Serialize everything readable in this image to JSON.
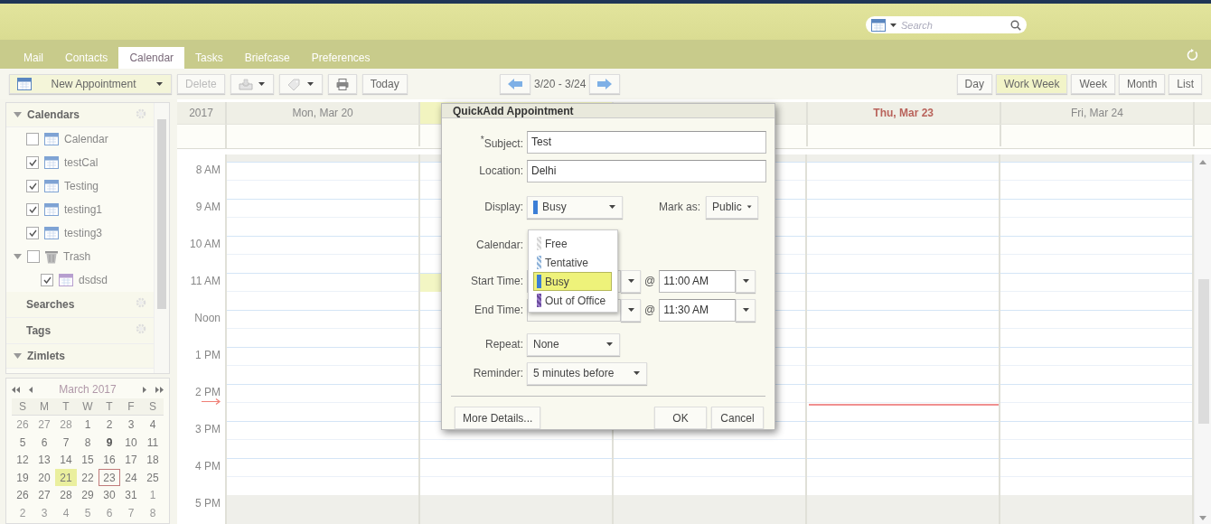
{
  "search": {
    "placeholder": "Search"
  },
  "tabs": [
    {
      "label": "Mail",
      "selected": false
    },
    {
      "label": "Contacts",
      "selected": false
    },
    {
      "label": "Calendar",
      "selected": true
    },
    {
      "label": "Tasks",
      "selected": false
    },
    {
      "label": "Briefcase",
      "selected": false
    },
    {
      "label": "Preferences",
      "selected": false
    }
  ],
  "toolbar": {
    "new_button": "New Appointment",
    "delete_button": "Delete",
    "today_button": "Today",
    "date_range": "3/20 - 3/24",
    "views": [
      {
        "label": "Day",
        "selected": false
      },
      {
        "label": "Work Week",
        "selected": true
      },
      {
        "label": "Week",
        "selected": false
      },
      {
        "label": "Month",
        "selected": false
      },
      {
        "label": "List",
        "selected": false
      }
    ]
  },
  "sidebar": {
    "sections": [
      {
        "title": "Calendars",
        "expanded": true,
        "items": [
          {
            "name": "Calendar",
            "kind": "calendar",
            "checked": false
          },
          {
            "name": "testCal",
            "kind": "calendar",
            "checked": true
          },
          {
            "name": "Testing",
            "kind": "calendar",
            "checked": true
          },
          {
            "name": "testing1",
            "kind": "calendar",
            "checked": true
          },
          {
            "name": "testing3",
            "kind": "calendar",
            "checked": true
          },
          {
            "name": "Trash",
            "kind": "trash",
            "checked": false,
            "children": [
              {
                "name": "dsdsd",
                "kind": "calendar",
                "checked": true
              }
            ]
          }
        ]
      },
      {
        "title": "Searches",
        "expanded": false
      },
      {
        "title": "Tags",
        "expanded": false
      },
      {
        "title": "Zimlets",
        "expanded": true
      }
    ]
  },
  "mini_calendar": {
    "title": "March 2017",
    "weekdays": [
      "S",
      "M",
      "T",
      "W",
      "T",
      "F",
      "S"
    ],
    "weeks": [
      [
        {
          "day": "26",
          "kind": "outside",
          "selected": false,
          "today": false
        },
        {
          "day": "27",
          "kind": "outside",
          "selected": false,
          "today": false
        },
        {
          "day": "28",
          "kind": "outside",
          "selected": false,
          "today": false
        },
        {
          "day": "1",
          "kind": "inside",
          "selected": false,
          "today": false
        },
        {
          "day": "2",
          "kind": "inside",
          "selected": false,
          "today": false
        },
        {
          "day": "3",
          "kind": "inside",
          "selected": false,
          "today": false
        },
        {
          "day": "4",
          "kind": "inside",
          "selected": false,
          "today": false
        }
      ],
      [
        {
          "day": "5",
          "kind": "inside",
          "selected": false,
          "today": false
        },
        {
          "day": "6",
          "kind": "inside",
          "selected": false,
          "today": false
        },
        {
          "day": "7",
          "kind": "inside",
          "selected": false,
          "today": false
        },
        {
          "day": "8",
          "kind": "inside",
          "selected": false,
          "today": false
        },
        {
          "day": "9",
          "kind": "busy",
          "selected": false,
          "today": false
        },
        {
          "day": "10",
          "kind": "inside",
          "selected": false,
          "today": false
        },
        {
          "day": "11",
          "kind": "inside",
          "selected": false,
          "today": false
        }
      ],
      [
        {
          "day": "12",
          "kind": "inside",
          "selected": false,
          "today": false
        },
        {
          "day": "13",
          "kind": "inside",
          "selected": false,
          "today": false
        },
        {
          "day": "14",
          "kind": "inside",
          "selected": false,
          "today": false
        },
        {
          "day": "15",
          "kind": "inside",
          "selected": false,
          "today": false
        },
        {
          "day": "16",
          "kind": "inside",
          "selected": false,
          "today": false
        },
        {
          "day": "17",
          "kind": "inside",
          "selected": false,
          "today": false
        },
        {
          "day": "18",
          "kind": "inside",
          "selected": false,
          "today": false
        }
      ],
      [
        {
          "day": "19",
          "kind": "inside",
          "selected": false,
          "today": false
        },
        {
          "day": "20",
          "kind": "inside",
          "selected": false,
          "today": false
        },
        {
          "day": "21",
          "kind": "inside",
          "selected": true,
          "today": false
        },
        {
          "day": "22",
          "kind": "inside",
          "selected": false,
          "today": false
        },
        {
          "day": "23",
          "kind": "inside",
          "selected": false,
          "today": true
        },
        {
          "day": "24",
          "kind": "inside",
          "selected": false,
          "today": false
        },
        {
          "day": "25",
          "kind": "inside",
          "selected": false,
          "today": false
        }
      ],
      [
        {
          "day": "26",
          "kind": "inside",
          "selected": false,
          "today": false
        },
        {
          "day": "27",
          "kind": "inside",
          "selected": false,
          "today": false
        },
        {
          "day": "28",
          "kind": "inside",
          "selected": false,
          "today": false
        },
        {
          "day": "29",
          "kind": "inside",
          "selected": false,
          "today": false
        },
        {
          "day": "30",
          "kind": "inside",
          "selected": false,
          "today": false
        },
        {
          "day": "31",
          "kind": "inside",
          "selected": false,
          "today": false
        },
        {
          "day": "1",
          "kind": "outside",
          "selected": false,
          "today": false
        }
      ],
      [
        {
          "day": "2",
          "kind": "outside",
          "selected": false,
          "today": false
        },
        {
          "day": "3",
          "kind": "outside",
          "selected": false,
          "today": false
        },
        {
          "day": "4",
          "kind": "outside",
          "selected": false,
          "today": false
        },
        {
          "day": "5",
          "kind": "outside",
          "selected": false,
          "today": false
        },
        {
          "day": "6",
          "kind": "outside",
          "selected": false,
          "today": false
        },
        {
          "day": "7",
          "kind": "outside",
          "selected": false,
          "today": false
        },
        {
          "day": "8",
          "kind": "outside",
          "selected": false,
          "today": false
        }
      ]
    ]
  },
  "week_view": {
    "year": "2017",
    "days": [
      {
        "label": "Mon, Mar 20",
        "selected": false,
        "today": false
      },
      {
        "selected": true,
        "today": false
      },
      {
        "selected": false,
        "today": false
      },
      {
        "label": "Thu, Mar 23",
        "selected": false,
        "today": true
      },
      {
        "label": "Fri, Mar 24",
        "selected": false,
        "today": false
      }
    ],
    "hours": [
      "8 AM",
      "9 AM",
      "10 AM",
      "11 AM",
      "Noon",
      "1 PM",
      "2 PM",
      "3 PM",
      "4 PM",
      "5 PM"
    ]
  },
  "dialog": {
    "title": "QuickAdd Appointment",
    "subject": {
      "required_mark": "*",
      "label": "Subject:",
      "value": "Test"
    },
    "location": {
      "label": "Location:",
      "value": "Delhi"
    },
    "display": {
      "label": "Display:",
      "value": "Busy"
    },
    "mark_as": {
      "label": "Mark as:",
      "value": "Public"
    },
    "calendar": {
      "label": "Calendar:"
    },
    "start": {
      "label": "Start Time:",
      "at": "@",
      "time": "11:00 AM"
    },
    "end": {
      "label": "End Time:",
      "at": "@",
      "time": "11:30 AM"
    },
    "repeat": {
      "label": "Repeat:",
      "value": "None"
    },
    "reminder": {
      "label": "Reminder:",
      "value": "5 minutes before"
    },
    "buttons": {
      "more": "More Details...",
      "ok": "OK",
      "cancel": "Cancel"
    },
    "display_menu": [
      {
        "label": "Free",
        "kind": "free",
        "color": "#d6d6d6",
        "selected": false
      },
      {
        "label": "Tentative",
        "kind": "tentative",
        "color": "#8fb3d9",
        "selected": false
      },
      {
        "label": "Busy",
        "kind": "busy",
        "color": "#3b7ed6",
        "selected": true
      },
      {
        "label": "Out of Office",
        "kind": "out",
        "color": "#6a4a9c",
        "selected": false
      }
    ]
  }
}
